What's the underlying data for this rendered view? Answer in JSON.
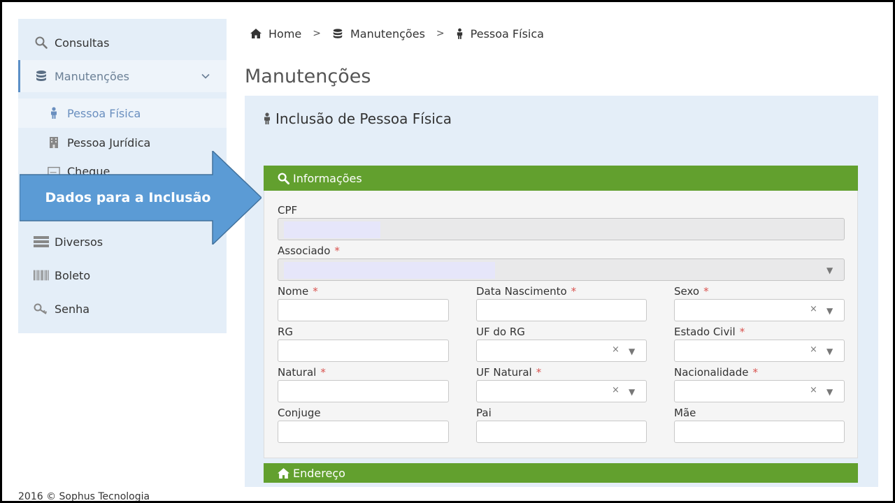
{
  "sidebar": {
    "items": [
      {
        "label": "Consultas",
        "icon": "search-icon"
      },
      {
        "label": "Manutenções",
        "icon": "database-icon"
      },
      {
        "label": "Pessoa Física",
        "icon": "person-icon"
      },
      {
        "label": "Pessoa Jurídica",
        "icon": "building-icon"
      },
      {
        "label": "Cheque",
        "icon": "cheque-icon"
      },
      {
        "label": "Diversos",
        "icon": "server-icon"
      },
      {
        "label": "Boleto",
        "icon": "barcode-icon"
      },
      {
        "label": "Senha",
        "icon": "key-icon"
      }
    ]
  },
  "callout": {
    "text": "Dados para a Inclusão",
    "color": "#5b9bd5"
  },
  "breadcrumb": {
    "items": [
      {
        "label": "Home",
        "icon": "home-icon"
      },
      {
        "label": "Manutenções",
        "icon": "database-icon"
      },
      {
        "label": "Pessoa Física",
        "icon": "person-icon"
      }
    ],
    "separator": ">"
  },
  "page": {
    "title": "Manutenções"
  },
  "panel": {
    "title": "Inclusão de Pessoa Física"
  },
  "sections": {
    "info": {
      "title": "Informações",
      "icon": "search-icon",
      "color": "#62a02e"
    },
    "endereco": {
      "title": "Endereço",
      "icon": "home-icon"
    }
  },
  "form": {
    "required_mark": "*",
    "clear_glyph": "×",
    "caret_glyph": "▼",
    "cpf": {
      "label": "CPF"
    },
    "associado": {
      "label": "Associado"
    },
    "nome": {
      "label": "Nome"
    },
    "data_nascimento": {
      "label": "Data Nascimento"
    },
    "sexo": {
      "label": "Sexo"
    },
    "rg": {
      "label": "RG"
    },
    "uf_rg": {
      "label": "UF do RG"
    },
    "estado_civil": {
      "label": "Estado Civil"
    },
    "natural": {
      "label": "Natural"
    },
    "uf_natural": {
      "label": "UF Natural"
    },
    "nacionalidade": {
      "label": "Nacionalidade"
    },
    "conjuge": {
      "label": "Conjuge"
    },
    "pai": {
      "label": "Pai"
    },
    "mae": {
      "label": "Mãe"
    }
  },
  "footer": {
    "text": "2016 © Sophus Tecnologia"
  }
}
